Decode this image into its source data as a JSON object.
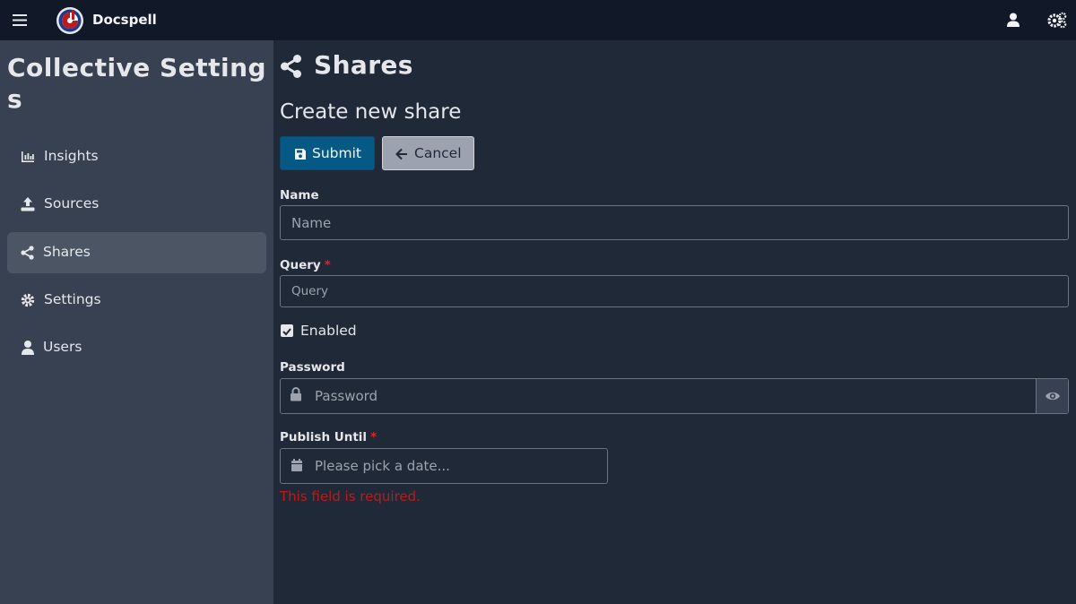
{
  "app": {
    "name": "Docspell"
  },
  "sidebar": {
    "title": "Collective Settings",
    "items": [
      {
        "label": "Insights",
        "icon": "chart-icon",
        "active": false
      },
      {
        "label": "Sources",
        "icon": "upload-icon",
        "active": false
      },
      {
        "label": "Shares",
        "icon": "share-icon",
        "active": true
      },
      {
        "label": "Settings",
        "icon": "gear-icon",
        "active": false
      },
      {
        "label": "Users",
        "icon": "user-icon",
        "active": false
      }
    ]
  },
  "main": {
    "title": "Shares",
    "subtitle": "Create new share",
    "submit_label": "Submit",
    "cancel_label": "Cancel",
    "form": {
      "name_label": "Name",
      "name_placeholder": "Name",
      "query_label": "Query",
      "query_placeholder": "Query",
      "enabled_label": "Enabled",
      "enabled_checked": true,
      "password_label": "Password",
      "password_placeholder": "Password",
      "publish_label": "Publish Until",
      "publish_placeholder": "Please pick a date...",
      "required_marker": "*",
      "error_text": "This field is required."
    }
  },
  "colors": {
    "topbar": "#111827",
    "sidebar": "#374151",
    "main_bg": "#1f2937",
    "primary": "#075985",
    "secondary": "#9ca3af",
    "error": "#b91c1c"
  }
}
